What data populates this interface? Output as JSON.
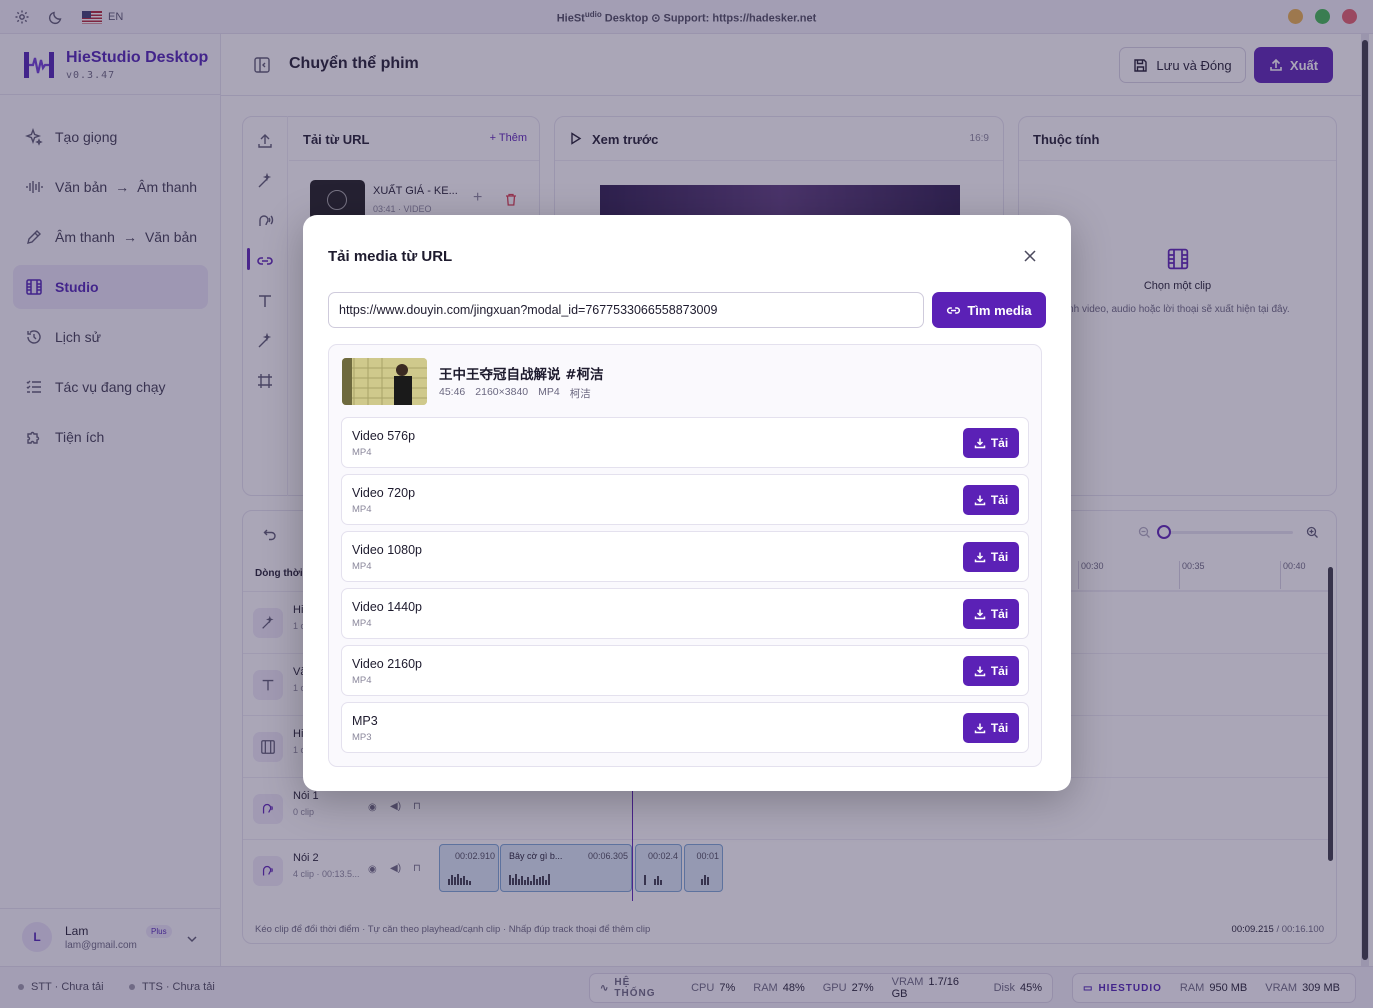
{
  "titlebar": {
    "lang": "EN",
    "title_pre": "HieSt",
    "title_sup": "udio",
    "title_post": " Desktop ⊙ Support: https://hadesker.net",
    "dots": [
      "#e9b04b",
      "#3fb950",
      "#e35d6a"
    ]
  },
  "brand": {
    "name": "HieStudio Desktop",
    "version": "v0.3.47",
    "accent": "#5b21b6"
  },
  "sidebar": {
    "items": [
      {
        "label": "Tạo giọng",
        "icon": "sparkle-icon"
      },
      {
        "label": "Văn bản",
        "label2": "Âm thanh",
        "icon": "waveform-icon"
      },
      {
        "label": "Âm thanh",
        "label2": "Văn bản",
        "icon": "pen-icon"
      },
      {
        "label": "Studio",
        "icon": "film-icon",
        "active": true
      },
      {
        "label": "Lịch sử",
        "icon": "history-icon"
      },
      {
        "label": "Tác vụ đang chạy",
        "icon": "list-icon"
      },
      {
        "label": "Tiện ích",
        "icon": "puzzle-icon"
      }
    ]
  },
  "user": {
    "initial": "L",
    "name": "Lam",
    "email": "lam@gmail.com",
    "plan": "Plus"
  },
  "header": {
    "title": "Chuyển thể phim",
    "save_label": "Lưu và Đóng",
    "export_label": "Xuất"
  },
  "media_panel": {
    "title": "Tải từ URL",
    "add_label": "+ Thêm",
    "item": {
      "name": "XUẤT GIÁ - KE...",
      "meta": "03:41 · VIDEO"
    }
  },
  "preview_panel": {
    "title": "Xem trước",
    "ratio": "16:9"
  },
  "props_panel": {
    "title": "Thuộc tính",
    "empty_title": "Chọn một clip",
    "empty_desc": "ình video, audio hoặc lời thoại sẽ xuất hiện tại đây."
  },
  "timeline": {
    "heading": "Dòng thời",
    "ticks": [
      "00:30",
      "00:35",
      "00:40"
    ],
    "tracks": [
      {
        "name": "Hi",
        "meta": "1 c",
        "icon": "magic-icon"
      },
      {
        "name": "Vă",
        "meta": "1 c",
        "icon": "text-icon"
      },
      {
        "name": "Hi",
        "meta": "1 c",
        "icon": "film-icon"
      },
      {
        "name": "Nói 1",
        "meta": "0 clip",
        "icon": "speech-icon"
      },
      {
        "name": "Nói 2",
        "meta": "4 clip · 00:13.5...",
        "icon": "speech-icon"
      }
    ],
    "clips": [
      {
        "label": "",
        "time": "00:02.910"
      },
      {
        "label": "Bây cờ gì b...",
        "time": "00:06.305"
      },
      {
        "label": "",
        "time": "00:02.4"
      },
      {
        "label": "",
        "time": "00:01"
      }
    ],
    "footer_hint": "Kéo clip để đổi thời điểm · Tự căn theo playhead/cạnh clip · Nhấp đúp track thoại để thêm clip",
    "current_time": "00:09.215",
    "total_time": "/ 00:16.100"
  },
  "statusbar": {
    "stt": "STT · Chưa tải",
    "tts": "TTS · Chưa tải",
    "system_label": "HỆ THỐNG",
    "cpu_k": "CPU",
    "cpu_v": "7%",
    "ram_k": "RAM",
    "ram_v": "48%",
    "gpu_k": "GPU",
    "gpu_v": "27%",
    "vram_k": "VRAM",
    "vram_v": "1.7/16 GB",
    "disk_k": "Disk",
    "disk_v": "45%",
    "app_label": "HIESTUDIO",
    "app_ram_k": "RAM",
    "app_ram_v": "950 MB",
    "app_vram_k": "VRAM",
    "app_vram_v": "309 MB"
  },
  "modal": {
    "title": "Tải media từ URL",
    "url_value": "https://www.douyin.com/jingxuan?modal_id=7677533066558873009",
    "find_label": "Tìm media",
    "result": {
      "title": "王中王夺冠自战解说 #柯洁",
      "duration": "45:46",
      "resolution": "2160×3840",
      "format": "MP4",
      "author": "柯洁"
    },
    "download_label": "Tải",
    "formats": [
      {
        "name": "Video 576p",
        "type": "MP4"
      },
      {
        "name": "Video 720p",
        "type": "MP4"
      },
      {
        "name": "Video 1080p",
        "type": "MP4"
      },
      {
        "name": "Video 1440p",
        "type": "MP4"
      },
      {
        "name": "Video 2160p",
        "type": "MP4"
      },
      {
        "name": "MP3",
        "type": "MP3"
      }
    ]
  }
}
